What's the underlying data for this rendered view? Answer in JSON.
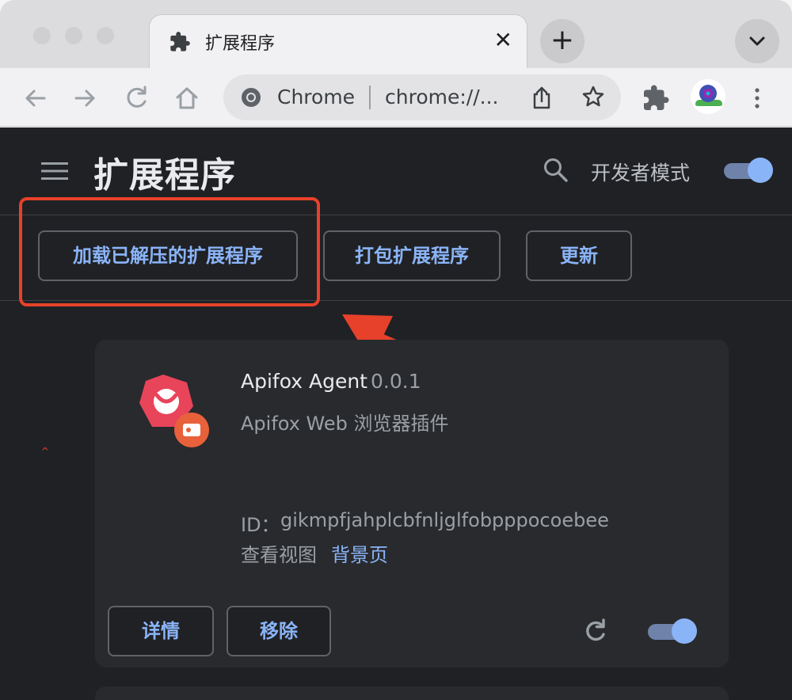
{
  "browser": {
    "tab": {
      "title": "扩展程序",
      "close_glyph": "✕",
      "icon": "puzzle-icon"
    },
    "new_tab_glyph": "+",
    "omnibox": {
      "site_label": "Chrome",
      "url": "chrome://..."
    },
    "colors": {
      "chrome_bg": "#f1f1f3",
      "tabstrip_bg": "#dcdcde"
    }
  },
  "page": {
    "title": "扩展程序",
    "developer_mode": {
      "label": "开发者模式",
      "enabled": true
    },
    "actions": {
      "load_unpacked": "加载已解压的扩展程序",
      "pack": "打包扩展程序",
      "update": "更新"
    },
    "annotation": {
      "color": "#e8412b",
      "caret": "^"
    },
    "colors": {
      "background": "#202124",
      "card": "#292a2d",
      "accent": "#8ab4f8"
    }
  },
  "extension": {
    "name": "Apifox Agent",
    "version": "0.0.1",
    "description": "Apifox Web 浏览器插件",
    "id_label": "ID：",
    "id": "gikmpfjahplcbfnljglfobpppocoebee",
    "views_label": "查看视图",
    "background_link": "背景页",
    "details_label": "详情",
    "remove_label": "移除",
    "enabled": true
  }
}
